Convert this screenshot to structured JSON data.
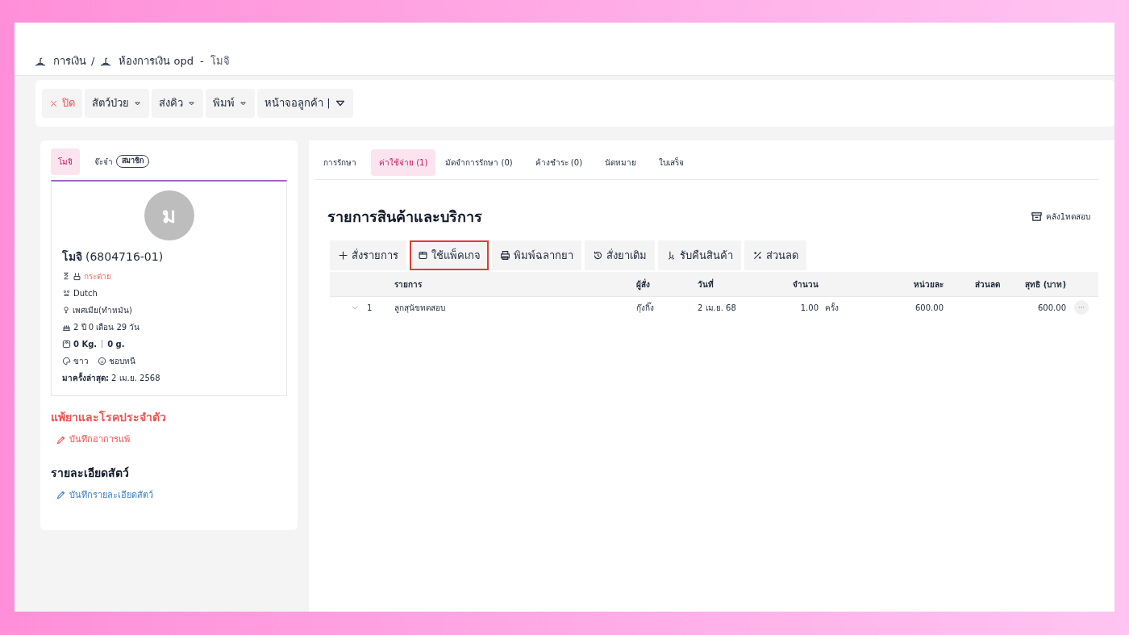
{
  "breadcrumb": {
    "items": [
      "การเงิน",
      "ห้องการเงิน opd"
    ],
    "separator": "/",
    "current_separator": "-",
    "current": "โมจิ"
  },
  "toolbar": [
    {
      "label": "ปิด",
      "kind": "close"
    },
    {
      "label": "สัตว์ป่วย",
      "kind": "dropdown"
    },
    {
      "label": "ส่งคิว",
      "kind": "dropdown"
    },
    {
      "label": "พิมพ์",
      "kind": "dropdown"
    },
    {
      "label": "หน้าจอลูกค้า |",
      "kind": "split"
    }
  ],
  "pet_tabs": [
    {
      "label": "โมจิ",
      "selected": true
    },
    {
      "label": "จ๊ะจ๋า",
      "badge": "สมาชิก",
      "selected": false
    }
  ],
  "pet": {
    "avatar_letter": "ม",
    "name": "โมจิ",
    "code": "(6804716-01)",
    "species": "กระต่าย",
    "breed": "Dutch",
    "sex": "เพศเมีย(ทำหมัน)",
    "age": "2 ปี 0 เดือน 29 วัน",
    "weight_kg": "0 Kg.",
    "weight_g": "0 g.",
    "coat": "ขาว",
    "temperament": "ชอบหนี",
    "last_visit_label": "มาครั้งล่าสุด:",
    "last_visit": "2 เม.ย. 2568"
  },
  "allergy": {
    "title": "แพ้ยาและโรคประจำตัว",
    "link": "บันทึกอาการแพ้"
  },
  "details": {
    "title": "รายละเอียดสัตว์",
    "link": "บันทึกรายละเอียดสัตว์"
  },
  "tabs": [
    {
      "label": "การรักษา",
      "selected": false
    },
    {
      "label": "ค่าใช้จ่าย (1)",
      "selected": true
    },
    {
      "label": "มัดจำการรักษา (0)",
      "selected": false
    },
    {
      "label": "ค้างชำระ (0)",
      "selected": false
    },
    {
      "label": "นัดหมาย",
      "selected": false
    },
    {
      "label": "ใบเสร็จ",
      "selected": false
    }
  ],
  "section": {
    "title": "รายการสินค้าและบริการ",
    "warehouse": "คลัง1ทดสอบ"
  },
  "actions": [
    {
      "label": "สั่งรายการ",
      "kind": "plus",
      "highlighted": false
    },
    {
      "label": "ใช้แพ็คเกจ",
      "kind": "package",
      "highlighted": true
    },
    {
      "label": "พิมพ์ฉลากยา",
      "kind": "print",
      "highlighted": false
    },
    {
      "label": "สั่งยาเดิม",
      "kind": "history",
      "highlighted": false
    },
    {
      "label": "รับคืนสินค้า",
      "kind": "return",
      "highlighted": false
    },
    {
      "label": "ส่วนลด",
      "kind": "percent",
      "highlighted": false
    }
  ],
  "table": {
    "columns": [
      "รายการ",
      "ผู้สั่ง",
      "วันที่",
      "จำนวน",
      "หน่วยละ",
      "ส่วนลด",
      "สุทธิ (บาท)"
    ],
    "rows": [
      {
        "index": "1",
        "item": "ลูกสุนัขทดสอบ",
        "orderer": "กุ๊งกิ๊ง",
        "date": "2 เม.ย. 68",
        "qty": "1.00",
        "unit": "ครั้ง",
        "unit_price": "600.00",
        "net": "600.00"
      }
    ]
  }
}
